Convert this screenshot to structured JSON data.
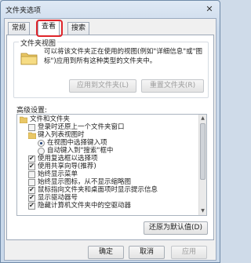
{
  "window": {
    "title": "文件夹选项",
    "close_glyph": "✕"
  },
  "tabs": [
    {
      "label": "常规",
      "active": false
    },
    {
      "label": "查看",
      "active": true
    },
    {
      "label": "搜索",
      "active": false
    }
  ],
  "highlight_color": "#e0242a",
  "folder_views": {
    "group_label": "文件夹视图",
    "description": "可以将该文件夹正在使用的视图(例如\"详细信息\"或\"图标\")应用到所有这种类型的文件夹中。",
    "apply_button": "应用到文件夹(L)",
    "reset_button": "重置文件夹(R)"
  },
  "advanced": {
    "label": "高级设置:",
    "items": [
      {
        "type": "folder",
        "text": "文件和文件夹",
        "indent": 0
      },
      {
        "type": "checkbox",
        "checked": false,
        "text": "登录时还原上一个文件夹窗口",
        "indent": 1
      },
      {
        "type": "folder",
        "text": "键入列表视图时",
        "indent": 1
      },
      {
        "type": "radio",
        "checked": true,
        "text": "在视图中选择键入项",
        "indent": 2
      },
      {
        "type": "radio",
        "checked": false,
        "text": "自动键入到\"搜索\"框中",
        "indent": 2
      },
      {
        "type": "checkbox",
        "checked": true,
        "text": "使用复选框以选择项",
        "indent": 1
      },
      {
        "type": "checkbox",
        "checked": true,
        "text": "使用共享向导(推荐)",
        "indent": 1
      },
      {
        "type": "checkbox",
        "checked": false,
        "text": "始终显示菜单",
        "indent": 1
      },
      {
        "type": "checkbox",
        "checked": false,
        "text": "始终显示图标，从不显示缩略图",
        "indent": 1
      },
      {
        "type": "checkbox",
        "checked": true,
        "text": "鼠标指向文件夹和桌面项时显示提示信息",
        "indent": 1
      },
      {
        "type": "checkbox",
        "checked": true,
        "text": "显示驱动器号",
        "indent": 1
      },
      {
        "type": "checkbox",
        "checked": true,
        "text": "隐藏计算机文件夹中的空驱动器",
        "indent": 1
      }
    ],
    "restore_button": "还原为默认值(D)"
  },
  "footer": {
    "ok": "确定",
    "cancel": "取消",
    "apply": "应用"
  }
}
